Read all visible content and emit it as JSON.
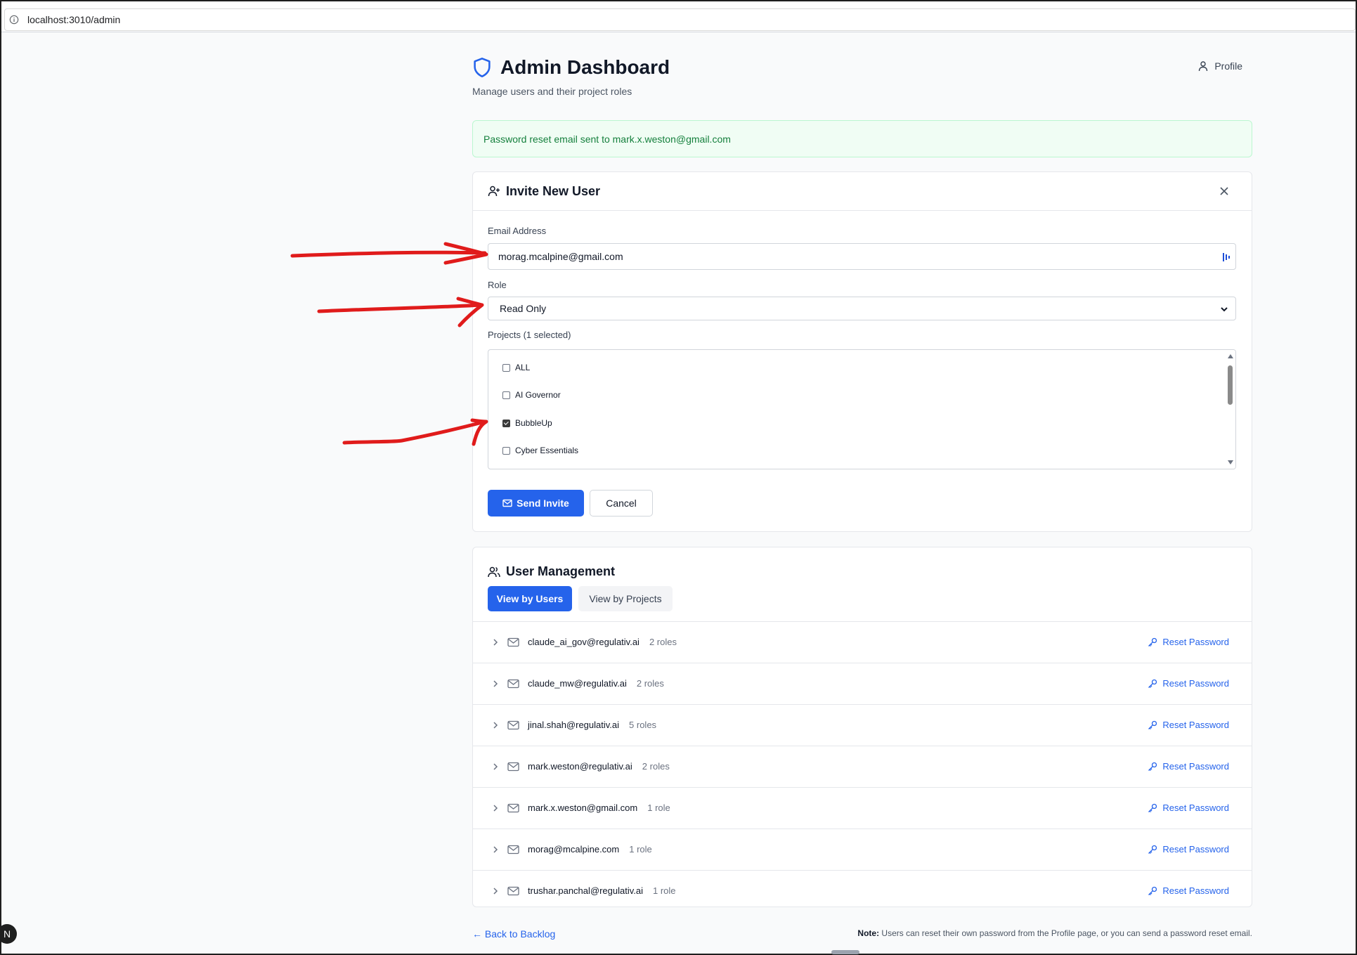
{
  "browser": {
    "url": "localhost:3010/admin"
  },
  "header": {
    "title": "Admin Dashboard",
    "subtitle": "Manage users and their project roles",
    "profile_label": "Profile"
  },
  "alert": {
    "message": "Password reset email sent to mark.x.weston@gmail.com"
  },
  "invite": {
    "title": "Invite New User",
    "email_label": "Email Address",
    "email_value": "morag.mcalpine@gmail.com",
    "role_label": "Role",
    "role_value": "Read Only",
    "projects_label": "Projects (1 selected)",
    "projects": [
      {
        "name": "ALL",
        "checked": false
      },
      {
        "name": "AI Governor",
        "checked": false
      },
      {
        "name": "BubbleUp",
        "checked": true
      },
      {
        "name": "Cyber Essentials",
        "checked": false
      }
    ],
    "send_label": "Send Invite",
    "cancel_label": "Cancel"
  },
  "user_management": {
    "title": "User Management",
    "tabs": [
      {
        "label": "View by Users",
        "active": true
      },
      {
        "label": "View by Projects",
        "active": false
      }
    ],
    "reset_label": "Reset Password",
    "users": [
      {
        "email": "claude_ai_gov@regulativ.ai",
        "roles": "2 roles"
      },
      {
        "email": "claude_mw@regulativ.ai",
        "roles": "2 roles"
      },
      {
        "email": "jinal.shah@regulativ.ai",
        "roles": "5 roles"
      },
      {
        "email": "mark.weston@regulativ.ai",
        "roles": "2 roles"
      },
      {
        "email": "mark.x.weston@gmail.com",
        "roles": "1 role"
      },
      {
        "email": "morag@mcalpine.com",
        "roles": "1 role"
      },
      {
        "email": "trushar.panchal@regulativ.ai",
        "roles": "1 role"
      }
    ]
  },
  "footer": {
    "back_link": "← Back to Backlog",
    "note_bold": "Note:",
    "note_text": " Users can reset their own password from the Profile page, or you can send a password reset email."
  },
  "badge": {
    "letter": "N"
  },
  "colors": {
    "accent": "#2563eb",
    "success_bg": "#f0fdf4",
    "success_text": "#15803d",
    "annotation": "#e01b1b"
  }
}
